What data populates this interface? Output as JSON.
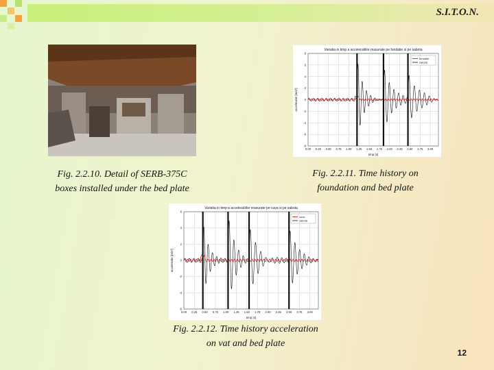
{
  "header": {
    "title": "S.I.T.O.N."
  },
  "colors": {
    "accent_orange": "#f3a33a",
    "accent_green": "#b8e26a",
    "trace_red": "#cc0000",
    "trace_black": "#111111"
  },
  "figures": [
    {
      "caption_line1": "Fig. 2.2.10. Detail of SERB-375C",
      "caption_line2": "boxes installed under the bed plate"
    },
    {
      "caption_line1": "Fig. 2.2.11. Time history on",
      "caption_line2": "foundation and bed plate"
    },
    {
      "caption_line1": "Fig. 2.2.12. Time history acceleration",
      "caption_line2": "on vat  and bed plate"
    }
  ],
  "chart_data": [
    {
      "type": "line",
      "title": "Variatia in timp a acceleratiilor masurate pe fundatie si pe sabota",
      "xlabel": "timp [s]",
      "ylabel": "acceleratie [m/s²]",
      "xlim": [
        0,
        3.2
      ],
      "ylim": [
        -8,
        8
      ],
      "x_ticks": [
        "0.00",
        "0.25",
        "0.50",
        "0.75",
        "1.00",
        "1.25",
        "1.50",
        "1.75",
        "2.00",
        "2.25",
        "2.50",
        "2.75",
        "3.00"
      ],
      "y_ticks": [
        "8",
        "6",
        "4",
        "2",
        "0",
        "-2",
        "-4",
        "-6",
        "-8"
      ],
      "legend": "top-right",
      "grid": true,
      "series": [
        {
          "name": "fundatie",
          "color": "#cc0000"
        },
        {
          "name": "sabota",
          "color": "#111111"
        }
      ]
    },
    {
      "type": "line",
      "title": "Variatia in timp a acceleratiilor masurate pe cuva si pe sabota",
      "xlabel": "timp [s]",
      "ylabel": "acceleratie [m/s²]",
      "xlim": [
        0,
        3.2
      ],
      "ylim": [
        -6,
        6
      ],
      "x_ticks": [
        "0.00",
        "0.25",
        "0.50",
        "0.75",
        "1.00",
        "1.25",
        "1.50",
        "1.75",
        "2.00",
        "2.25",
        "2.50",
        "2.75",
        "3.00"
      ],
      "y_ticks": [
        "6",
        "4",
        "2",
        "0",
        "-2",
        "-4",
        "-6"
      ],
      "legend": "top-right",
      "grid": true,
      "series": [
        {
          "name": "cuva",
          "color": "#cc0000"
        },
        {
          "name": "sabota",
          "color": "#111111"
        }
      ]
    }
  ],
  "page_number": "12"
}
